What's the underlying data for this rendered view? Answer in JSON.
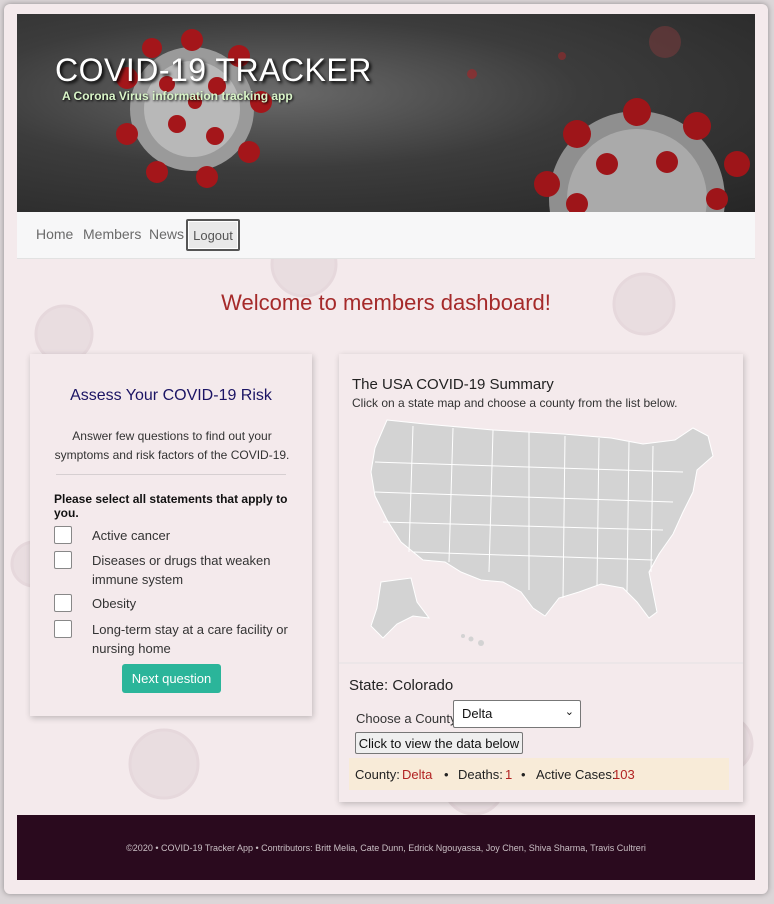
{
  "header": {
    "title": "COVID-19 TRACKER",
    "subtitle": "A Corona Virus information tracking app"
  },
  "nav": {
    "home": "Home",
    "members": "Members",
    "news": "News",
    "logout": "Logout"
  },
  "welcome": "Welcome to members dashboard!",
  "risk": {
    "title": "Assess Your COVID-19 Risk",
    "description": "Answer few questions to find out your symptoms and risk factors of the COVID-19.",
    "select_prompt": "Please select all statements that apply to you.",
    "options": [
      {
        "label": "Active cancer",
        "checked": false
      },
      {
        "label": "Diseases or drugs that weaken immune system",
        "checked": false
      },
      {
        "label": "Obesity",
        "checked": false
      },
      {
        "label": "Long-term stay at a care facility or nursing home",
        "checked": false
      }
    ],
    "next_button": "Next question"
  },
  "summary": {
    "title": "The USA COVID-19 Summary",
    "instructions": "Click on a state map and choose a county from the list below.",
    "state_label": "State: Colorado",
    "county_label": "Choose a County:",
    "county_selected": "Delta",
    "view_button": "Click to view the data below",
    "result": {
      "county_key": "County:",
      "county_value": "Delta",
      "deaths_key": "Deaths:",
      "deaths_value": "1",
      "active_key": "Active Cases:",
      "active_value": "103",
      "bullet": "•"
    }
  },
  "footer": "©2020 • COVID-19 Tracker App • Contributors: Britt Melia, Cate Dunn, Edrick Ngouyassa, Joy Chen, Shiva Sharma, Travis Cultreri",
  "colors": {
    "accent_red": "#a52a2a",
    "value_red": "#b22222",
    "title_navy": "#1b1464",
    "button_green": "#2bb59a",
    "footer_bg": "#2a0a1e",
    "map_grey": "#d3d3d3"
  }
}
